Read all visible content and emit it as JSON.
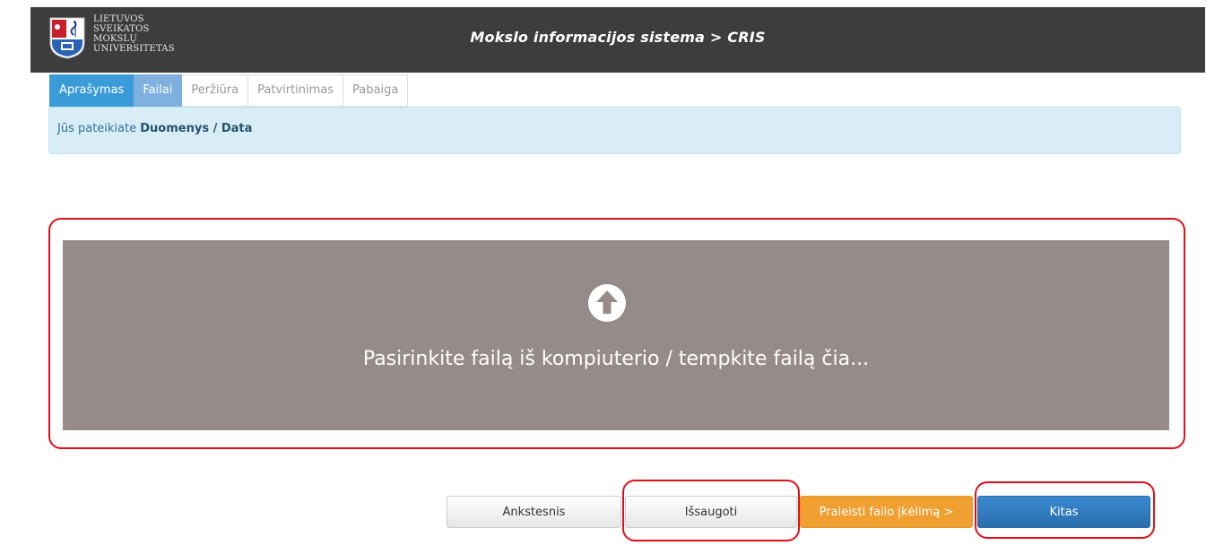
{
  "header": {
    "logo_lines": [
      "LIETUVOS",
      "SVEIKATOS",
      "MOKSLŲ",
      "UNIVERSITETAS"
    ],
    "title": "Mokslo informacijos sistema > CRIS"
  },
  "tabs": [
    {
      "label": "Aprašymas",
      "state": "active"
    },
    {
      "label": "Failai",
      "state": "current"
    },
    {
      "label": "Peržiūra",
      "state": "inactive"
    },
    {
      "label": "Patvirtinimas",
      "state": "inactive"
    },
    {
      "label": "Pabaiga",
      "state": "inactive"
    }
  ],
  "info": {
    "prefix": "Jūs pateikiate",
    "value": "Duomenys / Data"
  },
  "upload": {
    "text": "Pasirinkite failą iš kompiuterio / tempkite failą čia...",
    "icon": "upload-arrow-circle-icon"
  },
  "buttons": {
    "prev": "Ankstesnis",
    "save": "Išsaugoti",
    "skip": "Praleisti failo įkėlimą >",
    "next": "Kitas"
  },
  "colors": {
    "header_bg": "#3d3d3d",
    "dropzone_bg": "#958b88",
    "info_bg": "#d9edf7",
    "skip_btn": "#f0a030",
    "next_btn": "#2a6fae",
    "highlight": "#e0101a"
  }
}
